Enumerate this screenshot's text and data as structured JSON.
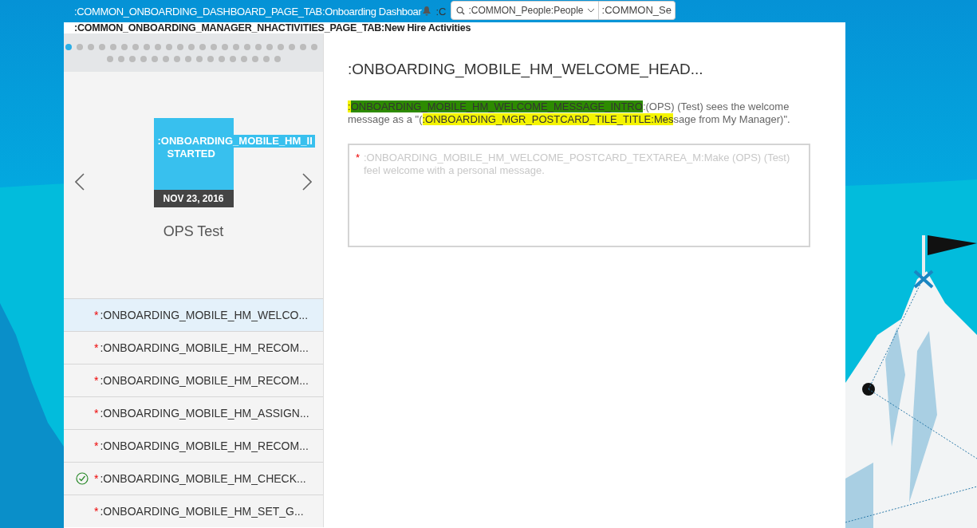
{
  "header": {
    "tabs": [
      {
        "label": ":COMMON_ONBOARDING_DASHBOARD_PAGE_TAB:Onboarding Dashboar",
        "selected": false
      },
      {
        "label": ":COMMON_ONBOARDING_MANAGER_NHACTIVITIES_PAGE_TAB:New Hire Activities",
        "selected": true
      }
    ],
    "user_initial": ":C",
    "search": {
      "scope": ":COMMON_People:People",
      "value": ":COMMON_Se"
    }
  },
  "pager": {
    "dots": [
      {
        "selected": true
      },
      {
        "selected": false
      },
      {
        "selected": false
      },
      {
        "selected": false
      },
      {
        "selected": false
      },
      {
        "selected": false
      },
      {
        "selected": false
      },
      {
        "selected": false
      },
      {
        "selected": false
      },
      {
        "selected": false
      },
      {
        "selected": false
      },
      {
        "selected": false
      },
      {
        "selected": false
      },
      {
        "selected": false
      },
      {
        "selected": false
      },
      {
        "selected": false
      },
      {
        "selected": false
      },
      {
        "selected": false
      },
      {
        "selected": false
      },
      {
        "selected": false
      },
      {
        "selected": false
      },
      {
        "selected": false
      },
      {
        "selected": false
      },
      {
        "selected": false
      },
      {
        "selected": false
      },
      {
        "selected": false
      },
      {
        "selected": false
      },
      {
        "selected": false
      },
      {
        "selected": false
      },
      {
        "selected": false
      },
      {
        "selected": false
      },
      {
        "selected": false
      },
      {
        "selected": false
      },
      {
        "selected": false
      },
      {
        "selected": false
      },
      {
        "selected": false
      },
      {
        "selected": false
      },
      {
        "selected": false
      },
      {
        "selected": false
      }
    ]
  },
  "hire_card": {
    "tile_title": ":ONBOARDING_MOBILE_HM_II",
    "tile_status": "STARTED",
    "date": "NOV 23, 2016",
    "name": "OPS Test"
  },
  "activities": [
    {
      "label": ":ONBOARDING_MOBILE_HM_WELCO...",
      "required_mark": "*",
      "completed": false,
      "selected": true
    },
    {
      "label": ":ONBOARDING_MOBILE_HM_RECOM...",
      "required_mark": "*",
      "completed": false,
      "selected": false
    },
    {
      "label": ":ONBOARDING_MOBILE_HM_RECOM...",
      "required_mark": "*",
      "completed": false,
      "selected": false
    },
    {
      "label": ":ONBOARDING_MOBILE_HM_ASSIGN...",
      "required_mark": "*",
      "completed": false,
      "selected": false
    },
    {
      "label": ":ONBOARDING_MOBILE_HM_RECOM...",
      "required_mark": "*",
      "completed": false,
      "selected": false
    },
    {
      "label": ":ONBOARDING_MOBILE_HM_CHECK...",
      "required_mark": "*",
      "completed": true,
      "selected": false
    },
    {
      "label": ":ONBOARDING_MOBILE_HM_SET_G...",
      "required_mark": "*",
      "completed": false,
      "selected": false
    }
  ],
  "detail": {
    "heading": ":ONBOARDING_MOBILE_HM_WELCOME_HEAD...",
    "intro": [
      {
        "text": ":",
        "color": "#f4f400"
      },
      {
        "text": "ONBOARDING_MOBILE_HM_WELCOME_MESSAGE_INTRO",
        "color": "#2d8b00"
      },
      {
        "text": ":(OPS) (Test) sees the welcome message as a \"("
      },
      {
        "text": ":ONBOARDING_MGR_POSTCARD_TILE_TITLE:Mes",
        "color": "#f4f400"
      },
      {
        "text": "sage from My Manager)\"."
      }
    ],
    "message": {
      "required_mark": "*",
      "placeholder": ":ONBOARDING_MOBILE_HM_WELCOME_POSTCARD_TEXTAREA_M:Make (OPS) (Test) feel welcome with a personal message."
    }
  }
}
